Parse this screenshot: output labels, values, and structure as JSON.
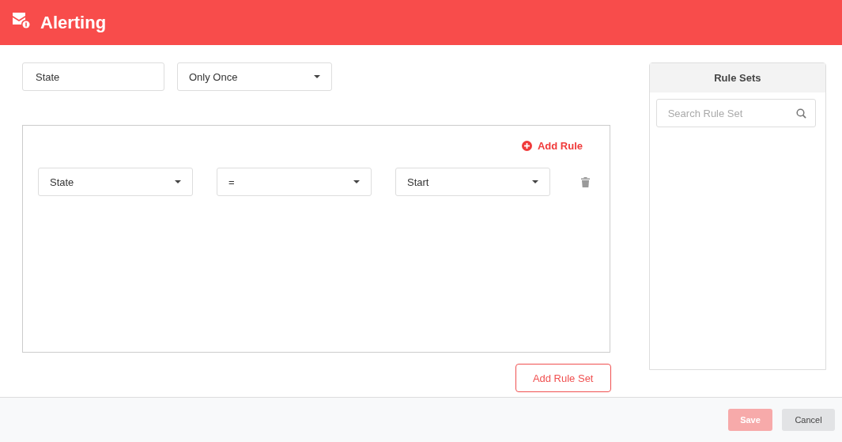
{
  "header": {
    "title": "Alerting"
  },
  "rule_set_name": {
    "value": "State"
  },
  "frequency": {
    "value": "Only Once"
  },
  "add_rule": {
    "label": "Add Rule"
  },
  "rules": [
    {
      "field": "State",
      "operator": "=",
      "value": "Start"
    }
  ],
  "add_rule_set": {
    "label": "Add Rule Set"
  },
  "rule_sets": {
    "title": "Rule Sets",
    "search": {
      "placeholder": "Search Rule Set"
    }
  },
  "footer_buttons": [
    {
      "label": "Save",
      "kind": "primary",
      "disabled": true
    },
    {
      "label": "Cancel",
      "kind": "secondary",
      "disabled": false
    }
  ]
}
